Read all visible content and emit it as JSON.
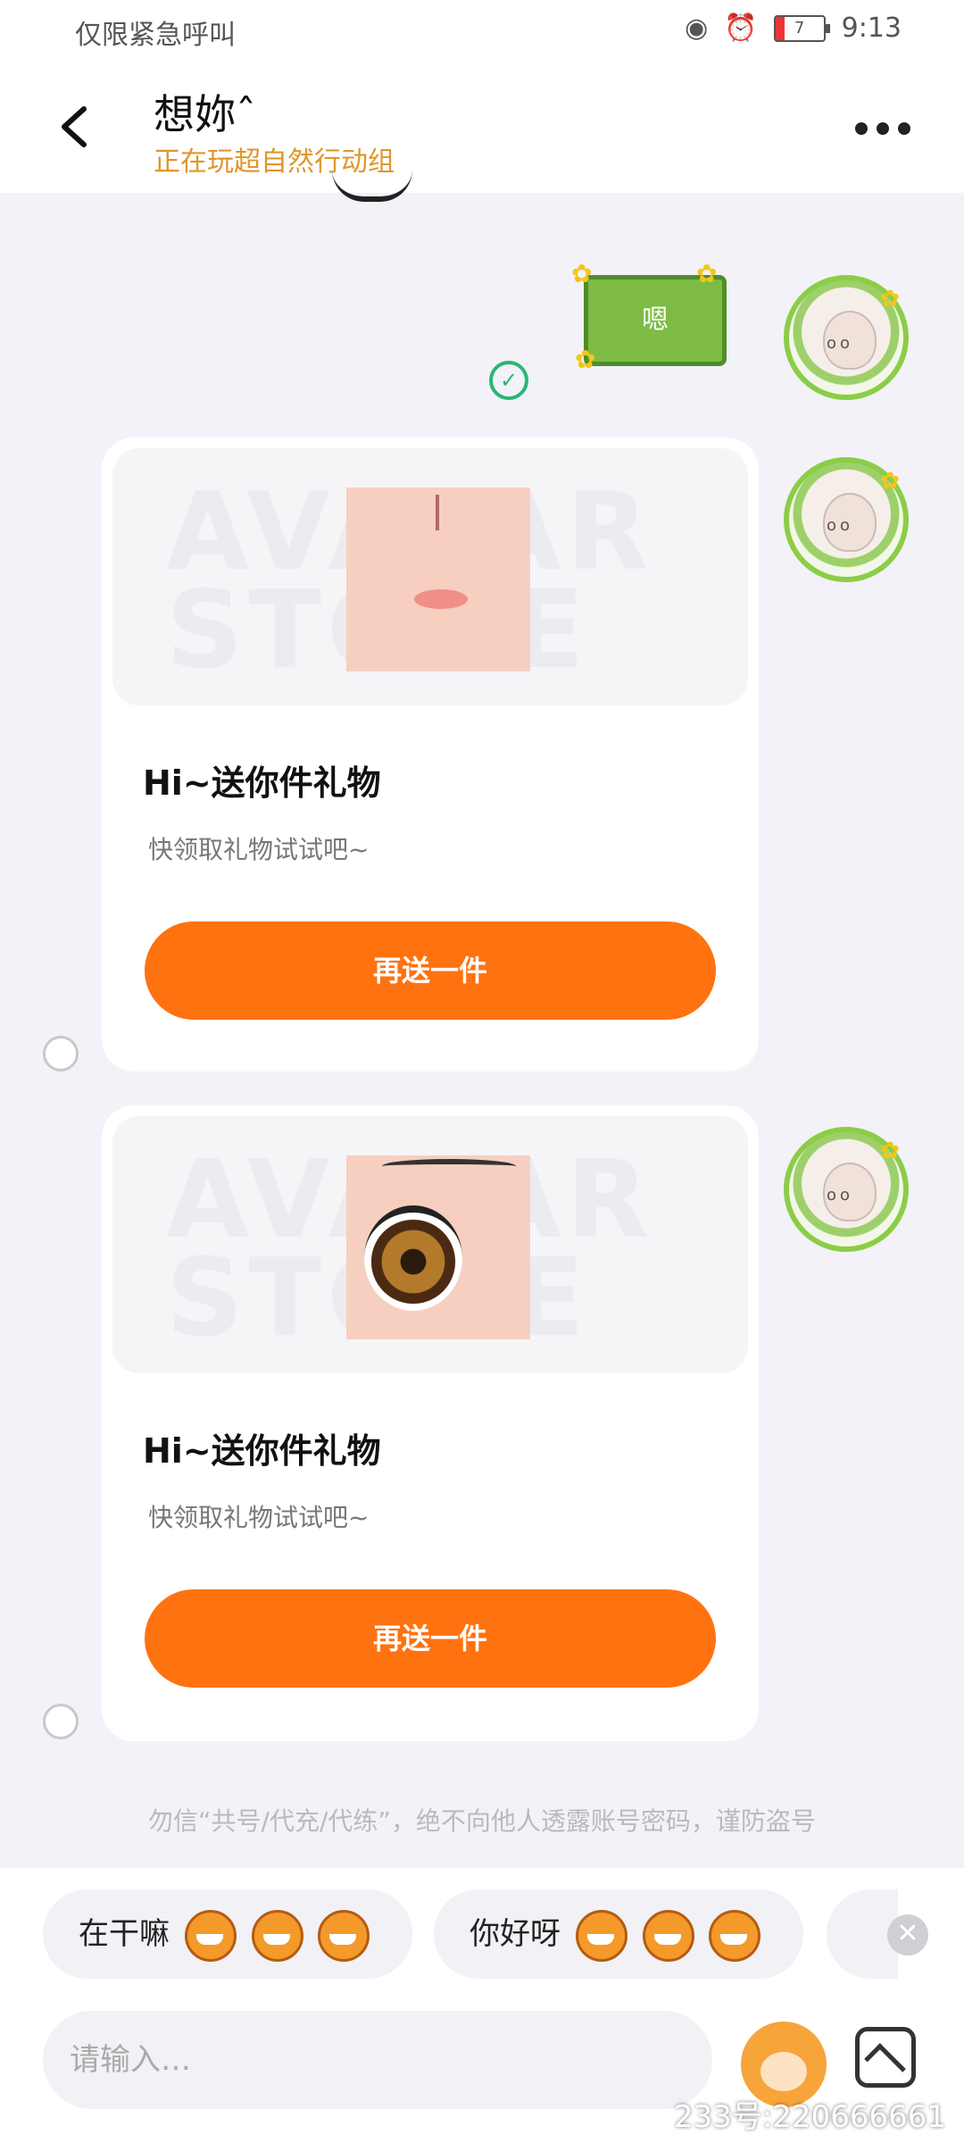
{
  "status_bar": {
    "left_text": "仅限紧急呼叫",
    "battery": "7",
    "time": "9:13"
  },
  "header": {
    "title": "想妳ˆ",
    "subtitle": "正在玩超自然行动组"
  },
  "sticker": {
    "text": "嗯"
  },
  "gift_cards": [
    {
      "watermark": "AVATAR STORE",
      "title": "Hi~送你件礼物",
      "description": "快领取礼物试试吧~",
      "button_label": "再送一件"
    },
    {
      "watermark": "AVATAR STORE",
      "title": "Hi~送你件礼物",
      "description": "快领取礼物试试吧~",
      "button_label": "再送一件"
    }
  ],
  "notice": "勿信“共号/代充/代练”，绝不向他人透露账号密码，谨防盗号",
  "quick_replies": [
    {
      "label": "在干嘛"
    },
    {
      "label": "你好呀"
    }
  ],
  "input": {
    "placeholder": "请输入…"
  },
  "footer_id": "233号:220666661",
  "colors": {
    "accent": "#ff7210",
    "subtitle": "#e0962b",
    "sent": "#2bb673"
  }
}
